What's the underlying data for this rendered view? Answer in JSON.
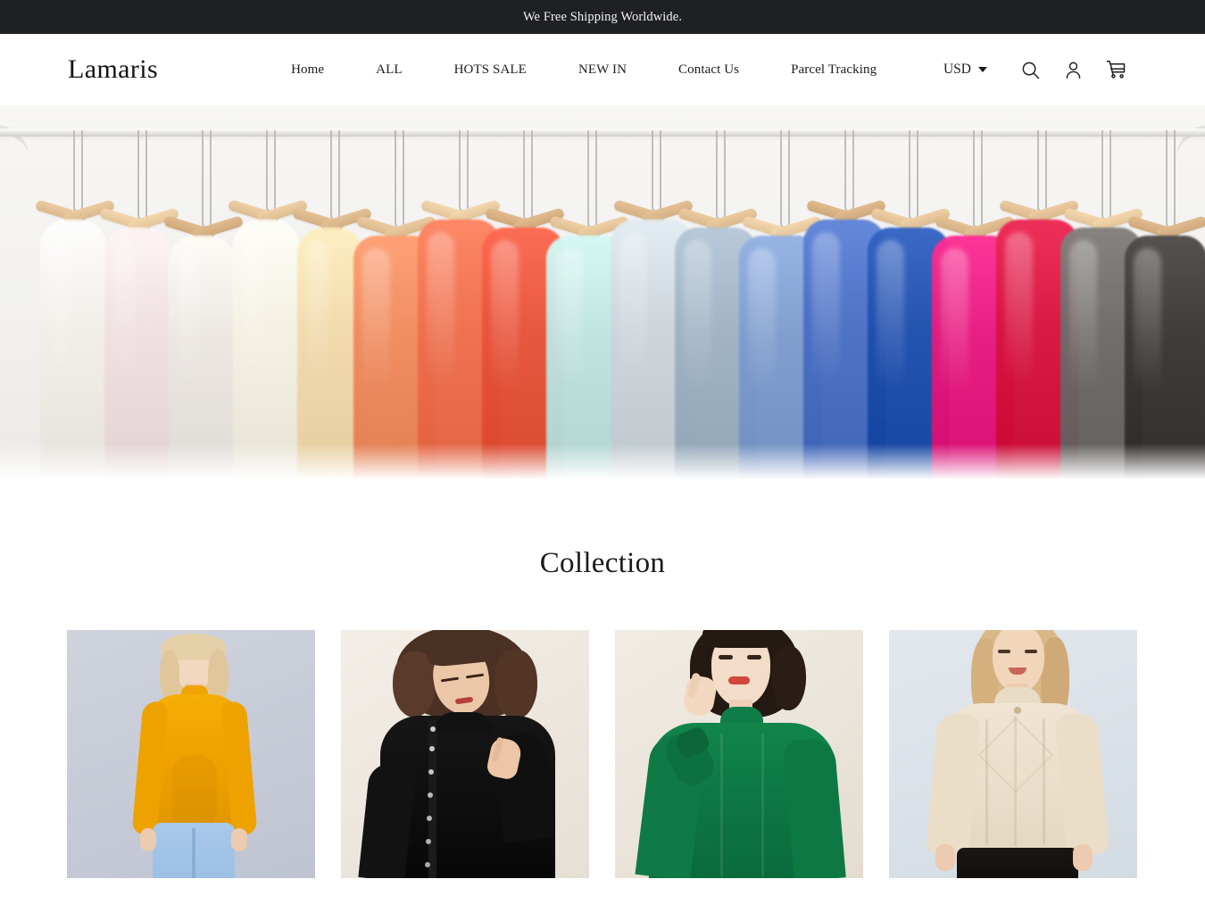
{
  "announcement": {
    "text": "We Free Shipping Worldwide."
  },
  "header": {
    "logo": "Lamaris",
    "nav": [
      {
        "label": "Home"
      },
      {
        "label": "ALL"
      },
      {
        "label": "HOTS SALE"
      },
      {
        "label": "NEW IN"
      },
      {
        "label": "Contact Us"
      },
      {
        "label": "Parcel Tracking"
      }
    ],
    "currency": {
      "value": "USD",
      "icon": "chevron-down-icon"
    },
    "icons": [
      {
        "name": "search-icon"
      },
      {
        "name": "account-icon"
      },
      {
        "name": "cart-icon"
      }
    ]
  },
  "hero": {
    "alt": "Clothing rack with colorful garments on wooden hangers",
    "garment_colors": [
      "#f3efe9",
      "#f0dfe0",
      "#ece7e2",
      "#f6f1e3",
      "#f2d9a8",
      "#f08a5d",
      "#ef6f4d",
      "#e8533a",
      "#bfe3e0",
      "#cdd6dc",
      "#9fb2c4",
      "#7e9ccf",
      "#4a6fc4",
      "#1f4fae",
      "#e8197f",
      "#d8143f",
      "#6e6a68",
      "#3a3735"
    ]
  },
  "collection": {
    "title": "Collection",
    "products": [
      {
        "name": "mustard-turtleneck-sweater",
        "sweater_color": "#f0a400",
        "background": "#c7cbd6",
        "hair_color": "#e6d0a8",
        "bottom_color": "#9dc0e6",
        "skin": "#f2d5bd"
      },
      {
        "name": "black-button-cardigan",
        "sweater_color": "#111111",
        "background": "#efe9e2",
        "hair_color": "#4a2f23",
        "bottom_color": "#111111",
        "skin": "#e8c3a6"
      },
      {
        "name": "green-mock-neck-sweater",
        "sweater_color": "#0e7a45",
        "background": "#efe9e1",
        "hair_color": "#241913",
        "bottom_color": "#0e7a45",
        "skin": "#f3dbc6"
      },
      {
        "name": "cream-cable-knit-turtleneck",
        "sweater_color": "#ece0cd",
        "background": "#dde4ea",
        "hair_color": "#d9b888",
        "bottom_color": "#14100f",
        "skin": "#f0d3b8"
      }
    ]
  }
}
